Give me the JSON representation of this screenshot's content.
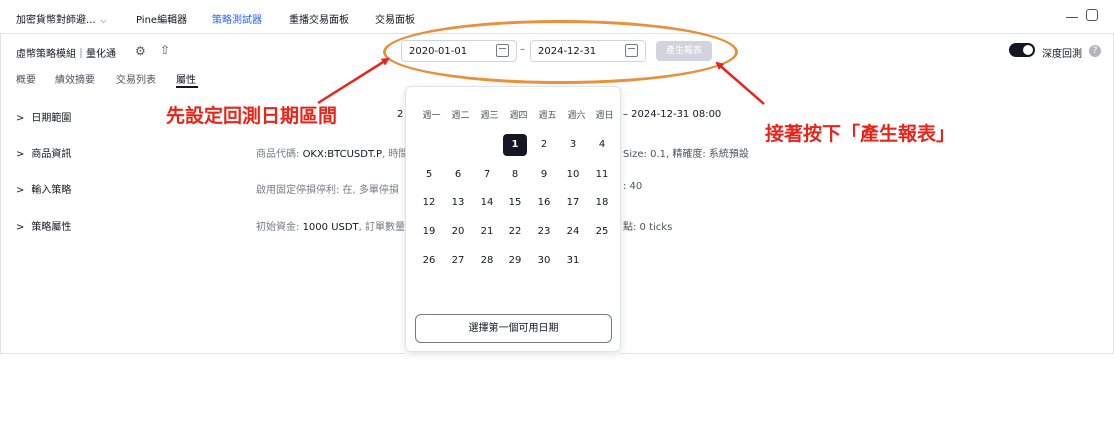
{
  "topbar": {
    "tabs": [
      {
        "label": "加密貨幣對師避...",
        "active": false
      },
      {
        "label": "Pine編輯器",
        "active": false
      },
      {
        "label": "策略測試器",
        "active": true
      },
      {
        "label": "重播交易面板",
        "active": false
      },
      {
        "label": "交易面板",
        "active": false
      }
    ],
    "dropdown_icon": "chevron-down-icon",
    "window_icons": [
      "minimize-icon",
      "maximize-icon"
    ]
  },
  "strategy": {
    "title": "虛幣策略模組｜量化通",
    "gear_icon": "gear-icon",
    "export_icon": "export-icon"
  },
  "subtabs": [
    {
      "label": "概要",
      "active": false
    },
    {
      "label": "績效摘要",
      "active": false
    },
    {
      "label": "交易列表",
      "active": false
    },
    {
      "label": "屬性",
      "active": true
    }
  ],
  "date_range": {
    "start": "2020-01-01",
    "end": "2024-12-31",
    "separator": "–",
    "generate_button": "產生報表"
  },
  "deep_backtest": {
    "label": "深度回測",
    "enabled": true,
    "info_icon": "?"
  },
  "rows": [
    {
      "label": "日期範圍",
      "value_left": "2",
      "value_right": "– 2024-12-31 08:00"
    },
    {
      "label": "商品資訊",
      "value_left_prefix": "商品代碼: ",
      "value_left_code": "OKX:BTCUSDT.P",
      "value_left_suffix": ", 時間",
      "value_right": "Size: 0.1, 精確度: 系統預設"
    },
    {
      "label": "輸入策略",
      "value_left": "啟用固定停損停利: 在, 多單停損",
      "value_right": ": 40"
    },
    {
      "label": "策略屬性",
      "value_left_prefix": "初始資金: ",
      "value_left_code": "1000 USDT",
      "value_left_suffix": ", 訂單數量:",
      "value_right": "點: 0 ticks"
    }
  ],
  "datepicker": {
    "weekdays": [
      "週一",
      "週二",
      "週三",
      "週四",
      "週五",
      "週六",
      "週日"
    ],
    "weeks": [
      [
        "",
        "",
        "",
        "1",
        "2",
        "3",
        "4"
      ],
      [
        "5",
        "6",
        "7",
        "8",
        "9",
        "10",
        "11"
      ],
      [
        "12",
        "13",
        "14",
        "15",
        "16",
        "17",
        "18"
      ],
      [
        "19",
        "20",
        "21",
        "22",
        "23",
        "24",
        "25"
      ],
      [
        "26",
        "27",
        "28",
        "29",
        "30",
        "31",
        ""
      ]
    ],
    "selected_day": "1",
    "button": "選擇第一個可用日期"
  },
  "annotations": {
    "step1": "先設定回測日期區間",
    "step2": "接著按下「產生報表」",
    "color": "#e8251b",
    "ellipse_color": "#e8903a"
  }
}
